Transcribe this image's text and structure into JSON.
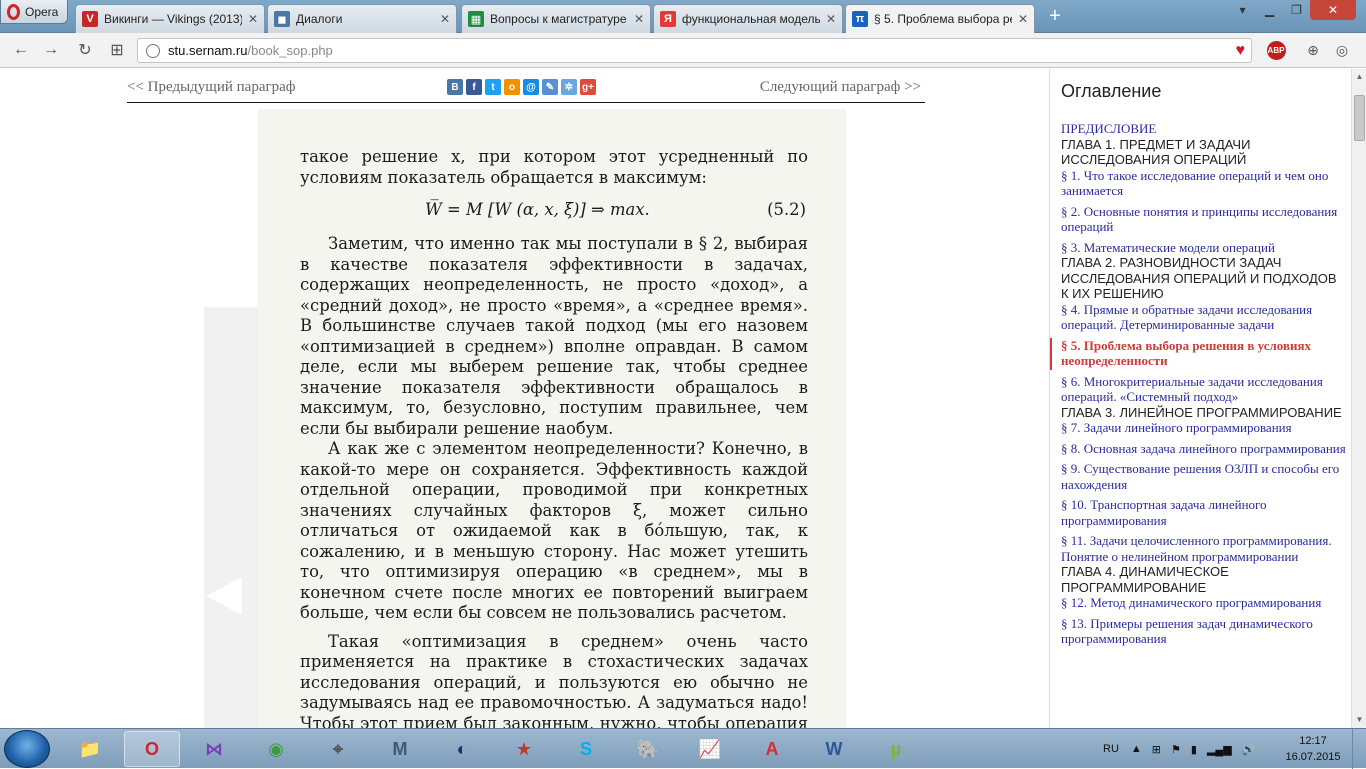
{
  "browser": {
    "menu_label": "Opera",
    "tabs": [
      {
        "title": "Викинги — Vikings (2013)",
        "favicon": "V",
        "color": "#c62828"
      },
      {
        "title": "Диалоги",
        "favicon": "◼",
        "color": "#4a76a8"
      },
      {
        "title": "Вопросы к магистратуре",
        "favicon": "▦",
        "color": "#1e8e3e"
      },
      {
        "title": "функциональная модель",
        "favicon": "Я",
        "color": "#e53935"
      },
      {
        "title": "§ 5. Проблема выбора ре",
        "favicon": "π",
        "color": "#1565c0"
      }
    ],
    "new_tab": "+",
    "url_domain": "stu.sernam.ru",
    "url_path": "/book_sop.php",
    "adblock_label": "ABP"
  },
  "nav": {
    "prev": "<< Предыдущий параграф",
    "next": "Следующий параграф >>",
    "share": [
      {
        "label": "В",
        "color": "#4a76a8"
      },
      {
        "label": "f",
        "color": "#3b5998"
      },
      {
        "label": "t",
        "color": "#1da1f2"
      },
      {
        "label": "o",
        "color": "#f39200"
      },
      {
        "label": "@",
        "color": "#168de2"
      },
      {
        "label": "✎",
        "color": "#5a8fd6"
      },
      {
        "label": "✲",
        "color": "#6aa7e0"
      },
      {
        "label": "g+",
        "color": "#dd4b39"
      }
    ]
  },
  "book": {
    "p0": "такое решение x, при котором этот усредненный по условиям показатель обращается в максимум:",
    "formula": "W̅ = M [W (α, x, ξ)] ⇒ max.",
    "formula_number": "(5.2)",
    "p1": "Заметим, что именно так мы поступали в § 2, выбирая в качестве показателя эффективности в задачах, содержащих неопределенность, не просто «доход», а «средний доход», не просто «время», а «среднее время». В большинстве случаев такой подход (мы его назовем «оптимизацией в среднем») вполне оправдан. В самом деле, если мы выберем решение так, чтобы среднее значение показателя эффективности обращалось в максимум, то, безусловно, поступим правильнее, чем если бы выбирали решение наобум.",
    "p2": "А как же с элементом неопределенности? Конечно, в какой-то мере он сохраняется. Эффективность каждой отдельной операции, проводимой при конкретных значениях случайных факторов ξ, может сильно отличаться от ожидаемой как в бóльшую, так, к сожалению, и в меньшую сторону. Нас может утешить то, что оптимизируя операцию «в среднем», мы в конечном счете после многих ее повторений выиграем больше, чем если бы совсем не пользовались расчетом.",
    "p3": "Такая «оптимизация в среднем» очень часто применяется на практике в стохастических задачах исследования операций, и пользуются ею обычно не задумываясь над ее правомочностью. А задуматься надо! Чтобы этот прием был законным, нужно, чтобы операция обладала свойством повторяемости и «накопления»"
  },
  "toc": {
    "title": "Оглавление",
    "items": [
      {
        "text": "ПРЕДИСЛОВИЕ",
        "kind": "pref"
      },
      {
        "text": "ГЛАВА 1. ПРЕДМЕТ И ЗАДАЧИ ИССЛЕДОВАНИЯ ОПЕРАЦИЙ",
        "kind": "chap"
      },
      {
        "text": "§ 1. Что такое исследование операций и чем оно занимается",
        "kind": "link"
      },
      {
        "text": "§ 2. Основные понятия и принципы исследования операций",
        "kind": "link"
      },
      {
        "text": "§ 3. Математические модели операций",
        "kind": "link-tight"
      },
      {
        "text": "ГЛАВА 2. РАЗНОВИДНОСТИ ЗАДАЧ ИССЛЕДОВАНИЯ ОПЕРАЦИЙ И ПОДХОДОВ К ИХ РЕШЕНИЮ",
        "kind": "chap"
      },
      {
        "text": "§ 4. Прямые и обратные задачи исследования операций. Детерминированные задачи",
        "kind": "link"
      },
      {
        "text": "§ 5. Проблема выбора решения в условиях неопределенности",
        "kind": "active"
      },
      {
        "text": "§ 6. Многокритериальные задачи исследования операций. «Системный подход»",
        "kind": "link-tight"
      },
      {
        "text": "ГЛАВА 3. ЛИНЕЙНОЕ ПРОГРАММИРОВАНИЕ",
        "kind": "chap"
      },
      {
        "text": "§ 7. Задачи линейного программирования",
        "kind": "link"
      },
      {
        "text": "§ 8. Основная задача линейного программирования",
        "kind": "link"
      },
      {
        "text": "§ 9. Существование решения ОЗЛП и способы его нахождения",
        "kind": "link"
      },
      {
        "text": "§ 10. Транспортная задача линейного программирования",
        "kind": "link"
      },
      {
        "text": "§ 11. Задачи целочисленного программирования. Понятие о нелинейном программировании",
        "kind": "link-tight"
      },
      {
        "text": "ГЛАВА 4. ДИНАМИЧЕСКОЕ ПРОГРАММИРОВАНИЕ",
        "kind": "chap"
      },
      {
        "text": "§ 12. Метод динамического программирования",
        "kind": "link"
      },
      {
        "text": "§ 13. Примеры решения задач динамического программирования",
        "kind": "link"
      }
    ]
  },
  "taskbar": {
    "apps": [
      {
        "name": "explorer-icon",
        "glyph": "📁",
        "color": "#e8b440",
        "open": false
      },
      {
        "name": "opera-icon",
        "glyph": "O",
        "color": "#d2232a",
        "open": true
      },
      {
        "name": "visual-studio-icon",
        "glyph": "⋈",
        "color": "#7a3fb8",
        "open": false
      },
      {
        "name": "chrome-icon",
        "glyph": "◉",
        "color": "#3a9d3a",
        "open": false
      },
      {
        "name": "network-icon",
        "glyph": "⌖",
        "color": "#555",
        "open": false
      },
      {
        "name": "m-app-icon",
        "glyph": "M",
        "color": "#3a5a7a",
        "open": false
      },
      {
        "name": "eclipse-icon",
        "glyph": "◐",
        "color": "#2c2a6a",
        "open": false
      },
      {
        "name": "star-app-icon",
        "glyph": "★",
        "color": "#c0392b",
        "open": false
      },
      {
        "name": "skype-icon",
        "glyph": "S",
        "color": "#00aff0",
        "open": false
      },
      {
        "name": "postgres-icon",
        "glyph": "🐘",
        "color": "#336791",
        "open": false
      },
      {
        "name": "chart-app-icon",
        "glyph": "📈",
        "color": "#2e7d32",
        "open": false
      },
      {
        "name": "pdf-icon",
        "glyph": "A",
        "color": "#d32f2f",
        "open": false
      },
      {
        "name": "word-icon",
        "glyph": "W",
        "color": "#2b579a",
        "open": false
      },
      {
        "name": "utorrent-icon",
        "glyph": "µ",
        "color": "#77b829",
        "open": false
      }
    ],
    "lang": "RU",
    "time": "12:17",
    "date": "16.07.2015"
  }
}
